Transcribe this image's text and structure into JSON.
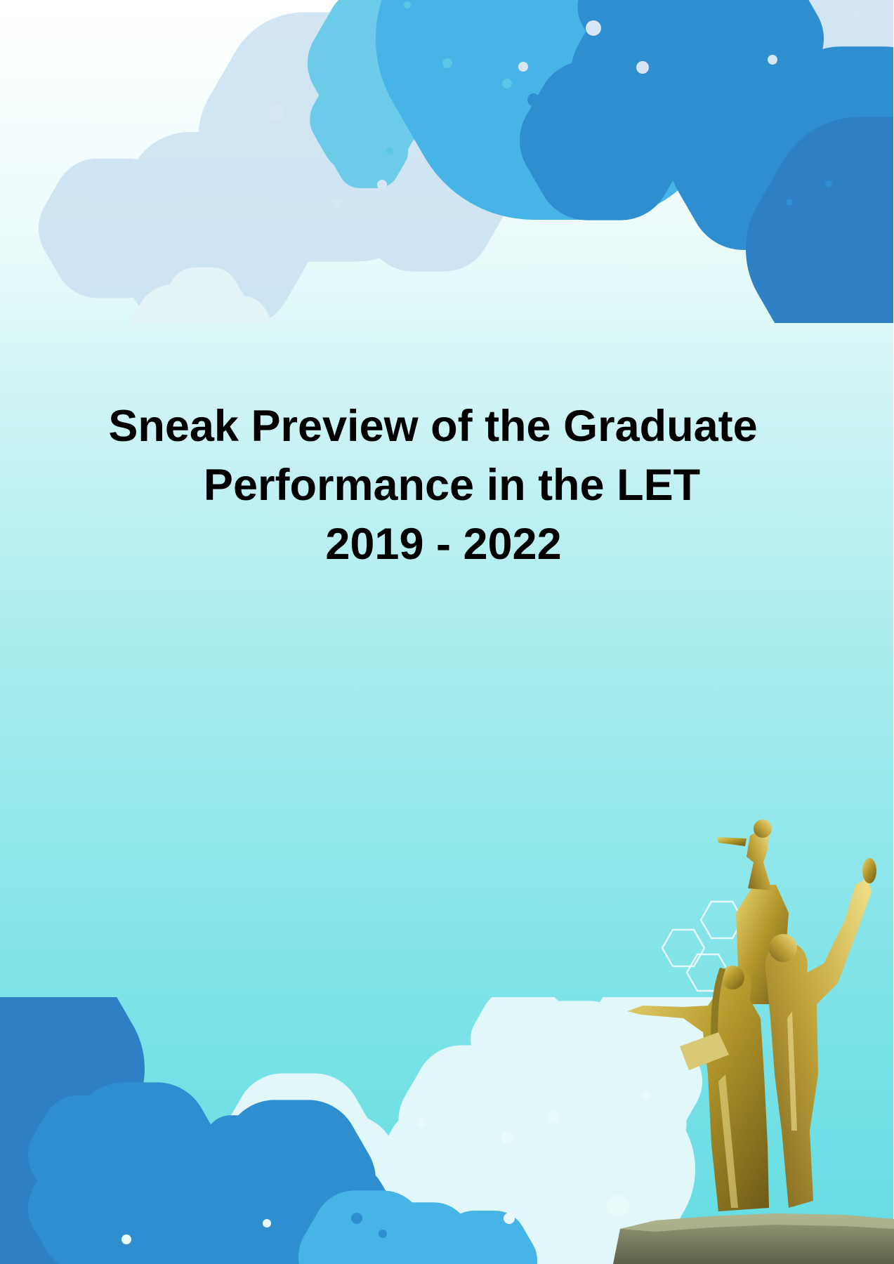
{
  "cover": {
    "title_line1": "Sneak Preview of the Graduate",
    "title_line2": "Performance in the LET",
    "title_line3": "2019 - 2022"
  },
  "colors": {
    "background_top": "#ffffff",
    "background_bottom": "#63dce2",
    "hex_blue": "#2a86c8",
    "hex_light": "#5cc6e8",
    "statue_gold": "#b69a2c"
  }
}
